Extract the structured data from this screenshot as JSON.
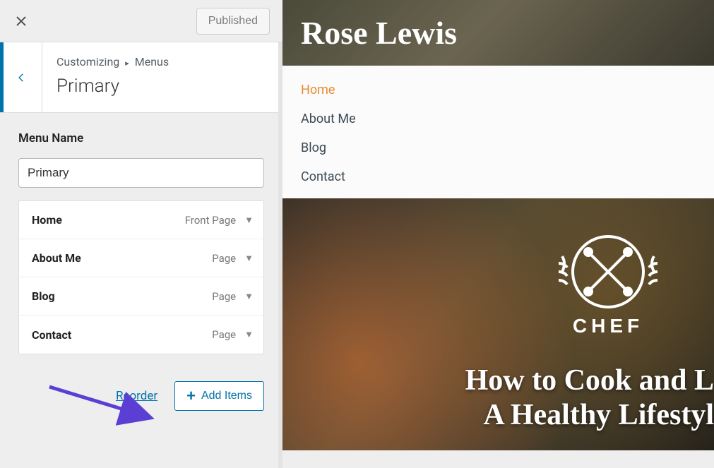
{
  "topbar": {
    "publish_label": "Published"
  },
  "breadcrumb": {
    "root": "Customizing",
    "section": "Menus",
    "title": "Primary"
  },
  "menu_name": {
    "label": "Menu Name",
    "value": "Primary"
  },
  "items": [
    {
      "title": "Home",
      "type": "Front Page"
    },
    {
      "title": "About Me",
      "type": "Page"
    },
    {
      "title": "Blog",
      "type": "Page"
    },
    {
      "title": "Contact",
      "type": "Page"
    }
  ],
  "actions": {
    "reorder": "Reorder",
    "add_items": "Add Items"
  },
  "preview": {
    "brand": "Rose Lewis",
    "nav": [
      {
        "label": "Home",
        "active": true
      },
      {
        "label": "About Me",
        "active": false
      },
      {
        "label": "Blog",
        "active": false
      },
      {
        "label": "Contact",
        "active": false
      }
    ],
    "badge_text": "CHEF",
    "hero_line1": "How to Cook and L",
    "hero_line2": "A Healthy Lifestyl"
  }
}
